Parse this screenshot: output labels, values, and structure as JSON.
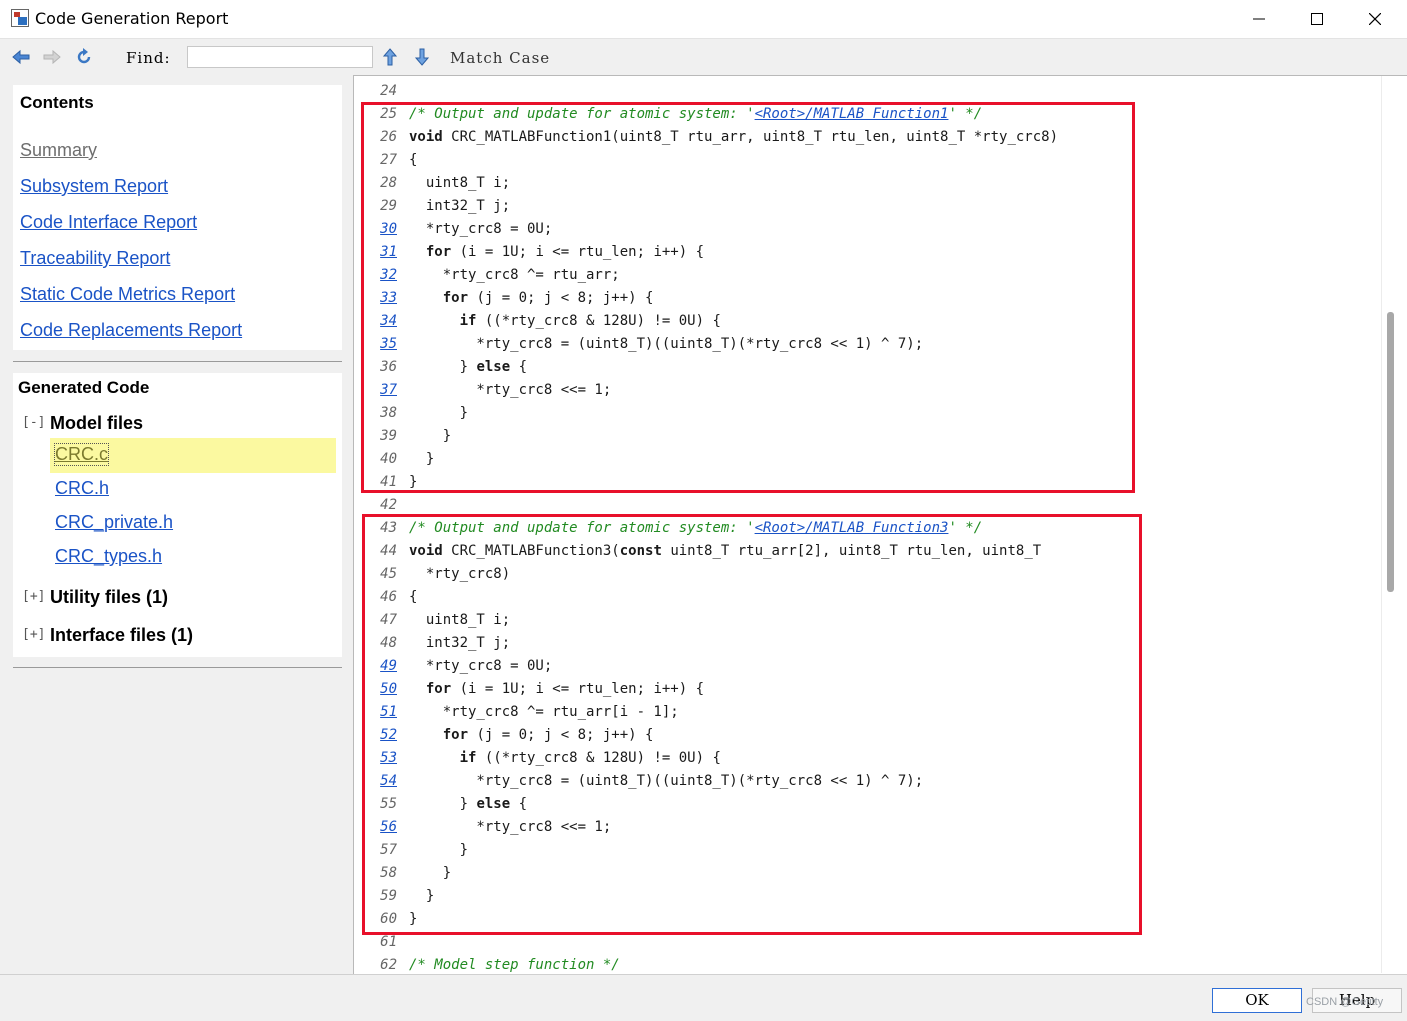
{
  "window": {
    "title": "Code Generation Report",
    "controls": {
      "minimize": "minimize-icon",
      "maximize": "maximize-icon",
      "close": "close-icon"
    }
  },
  "toolbar": {
    "back_icon": "arrow-left-icon",
    "forward_icon": "arrow-right-icon",
    "refresh_icon": "refresh-icon",
    "find_label": "Find:",
    "find_value": "",
    "up_icon": "arrow-up-icon",
    "down_icon": "arrow-down-icon",
    "match_case": "Match Case"
  },
  "sidebar": {
    "contents_heading": "Contents",
    "links": [
      "Summary",
      "Subsystem Report",
      "Code Interface Report",
      "Traceability Report",
      "Static Code Metrics Report",
      "Code Replacements Report"
    ],
    "generated_heading": "Generated Code",
    "model_files": {
      "toggle": "[-]",
      "label": "Model files",
      "files": [
        "CRC.c",
        "CRC.h",
        "CRC_private.h",
        "CRC_types.h"
      ],
      "selected": "CRC.c"
    },
    "utility_files": {
      "toggle": "[+]",
      "label": "Utility files (1)"
    },
    "interface_files": {
      "toggle": "[+]",
      "label": "Interface files (1)"
    }
  },
  "code": {
    "lines": [
      {
        "n": "24",
        "link": false,
        "segs": []
      },
      {
        "n": "25",
        "link": false,
        "segs": [
          {
            "t": "/* Output and update for atomic system: '",
            "c": "cmt"
          },
          {
            "t": "<Root>/MATLAB Function1",
            "c": "cmtlink"
          },
          {
            "t": "' */",
            "c": "cmt"
          }
        ]
      },
      {
        "n": "26",
        "link": false,
        "segs": [
          {
            "t": "void",
            "c": "kw"
          },
          {
            "t": " CRC_MATLABFunction1(uint8_T rtu_arr, uint8_T rtu_len, uint8_T *rty_crc8)",
            "c": ""
          }
        ]
      },
      {
        "n": "27",
        "link": false,
        "segs": [
          {
            "t": "{",
            "c": ""
          }
        ]
      },
      {
        "n": "28",
        "link": false,
        "segs": [
          {
            "t": "  uint8_T i;",
            "c": ""
          }
        ]
      },
      {
        "n": "29",
        "link": false,
        "segs": [
          {
            "t": "  int32_T j;",
            "c": ""
          }
        ]
      },
      {
        "n": "30",
        "link": true,
        "segs": [
          {
            "t": "  *rty_crc8 = 0U;",
            "c": ""
          }
        ]
      },
      {
        "n": "31",
        "link": true,
        "segs": [
          {
            "t": "  ",
            "c": ""
          },
          {
            "t": "for",
            "c": "kw"
          },
          {
            "t": " (i = 1U; i <= rtu_len; i++) {",
            "c": ""
          }
        ]
      },
      {
        "n": "32",
        "link": true,
        "segs": [
          {
            "t": "    *rty_crc8 ^= rtu_arr;",
            "c": ""
          }
        ]
      },
      {
        "n": "33",
        "link": true,
        "segs": [
          {
            "t": "    ",
            "c": ""
          },
          {
            "t": "for",
            "c": "kw"
          },
          {
            "t": " (j = 0; j < 8; j++) {",
            "c": ""
          }
        ]
      },
      {
        "n": "34",
        "link": true,
        "segs": [
          {
            "t": "      ",
            "c": ""
          },
          {
            "t": "if",
            "c": "kw"
          },
          {
            "t": " ((*rty_crc8 & 128U) != 0U) {",
            "c": ""
          }
        ]
      },
      {
        "n": "35",
        "link": true,
        "segs": [
          {
            "t": "        *rty_crc8 = (uint8_T)((uint8_T)(*rty_crc8 << 1) ^ 7);",
            "c": ""
          }
        ]
      },
      {
        "n": "36",
        "link": false,
        "segs": [
          {
            "t": "      } ",
            "c": ""
          },
          {
            "t": "else",
            "c": "kw"
          },
          {
            "t": " {",
            "c": ""
          }
        ]
      },
      {
        "n": "37",
        "link": true,
        "segs": [
          {
            "t": "        *rty_crc8 <<= 1;",
            "c": ""
          }
        ]
      },
      {
        "n": "38",
        "link": false,
        "segs": [
          {
            "t": "      }",
            "c": ""
          }
        ]
      },
      {
        "n": "39",
        "link": false,
        "segs": [
          {
            "t": "    }",
            "c": ""
          }
        ]
      },
      {
        "n": "40",
        "link": false,
        "segs": [
          {
            "t": "  }",
            "c": ""
          }
        ]
      },
      {
        "n": "41",
        "link": false,
        "segs": [
          {
            "t": "}",
            "c": ""
          }
        ]
      },
      {
        "n": "42",
        "link": false,
        "segs": []
      },
      {
        "n": "43",
        "link": false,
        "segs": [
          {
            "t": "/* Output and update for atomic system: '",
            "c": "cmt"
          },
          {
            "t": "<Root>/MATLAB Function3",
            "c": "cmtlink"
          },
          {
            "t": "' */",
            "c": "cmt"
          }
        ]
      },
      {
        "n": "44",
        "link": false,
        "segs": [
          {
            "t": "void",
            "c": "kw"
          },
          {
            "t": " CRC_MATLABFunction3(",
            "c": ""
          },
          {
            "t": "const",
            "c": "kw"
          },
          {
            "t": " uint8_T rtu_arr[2], uint8_T rtu_len, uint8_T",
            "c": ""
          }
        ]
      },
      {
        "n": "45",
        "link": false,
        "segs": [
          {
            "t": "  *rty_crc8)",
            "c": ""
          }
        ]
      },
      {
        "n": "46",
        "link": false,
        "segs": [
          {
            "t": "{",
            "c": ""
          }
        ]
      },
      {
        "n": "47",
        "link": false,
        "segs": [
          {
            "t": "  uint8_T i;",
            "c": ""
          }
        ]
      },
      {
        "n": "48",
        "link": false,
        "segs": [
          {
            "t": "  int32_T j;",
            "c": ""
          }
        ]
      },
      {
        "n": "49",
        "link": true,
        "segs": [
          {
            "t": "  *rty_crc8 = 0U;",
            "c": ""
          }
        ]
      },
      {
        "n": "50",
        "link": true,
        "segs": [
          {
            "t": "  ",
            "c": ""
          },
          {
            "t": "for",
            "c": "kw"
          },
          {
            "t": " (i = 1U; i <= rtu_len; i++) {",
            "c": ""
          }
        ]
      },
      {
        "n": "51",
        "link": true,
        "segs": [
          {
            "t": "    *rty_crc8 ^= rtu_arr[i - 1];",
            "c": ""
          }
        ]
      },
      {
        "n": "52",
        "link": true,
        "segs": [
          {
            "t": "    ",
            "c": ""
          },
          {
            "t": "for",
            "c": "kw"
          },
          {
            "t": " (j = 0; j < 8; j++) {",
            "c": ""
          }
        ]
      },
      {
        "n": "53",
        "link": true,
        "segs": [
          {
            "t": "      ",
            "c": ""
          },
          {
            "t": "if",
            "c": "kw"
          },
          {
            "t": " ((*rty_crc8 & 128U) != 0U) {",
            "c": ""
          }
        ]
      },
      {
        "n": "54",
        "link": true,
        "segs": [
          {
            "t": "        *rty_crc8 = (uint8_T)((uint8_T)(*rty_crc8 << 1) ^ 7);",
            "c": ""
          }
        ]
      },
      {
        "n": "55",
        "link": false,
        "segs": [
          {
            "t": "      } ",
            "c": ""
          },
          {
            "t": "else",
            "c": "kw"
          },
          {
            "t": " {",
            "c": ""
          }
        ]
      },
      {
        "n": "56",
        "link": true,
        "segs": [
          {
            "t": "        *rty_crc8 <<= 1;",
            "c": ""
          }
        ]
      },
      {
        "n": "57",
        "link": false,
        "segs": [
          {
            "t": "      }",
            "c": ""
          }
        ]
      },
      {
        "n": "58",
        "link": false,
        "segs": [
          {
            "t": "    }",
            "c": ""
          }
        ]
      },
      {
        "n": "59",
        "link": false,
        "segs": [
          {
            "t": "  }",
            "c": ""
          }
        ]
      },
      {
        "n": "60",
        "link": false,
        "segs": [
          {
            "t": "}",
            "c": ""
          }
        ]
      },
      {
        "n": "61",
        "link": false,
        "segs": []
      },
      {
        "n": "62",
        "link": false,
        "segs": [
          {
            "t": "/* Model step function */",
            "c": "cmt"
          }
        ]
      }
    ]
  },
  "buttons": {
    "ok": "OK",
    "help": "Help"
  },
  "watermark": "CSDN @Getitty",
  "colors": {
    "link": "#1a53c6",
    "comment": "#228b22",
    "highlight": "#fbf9a0",
    "annotation_box": "#e8102a"
  }
}
